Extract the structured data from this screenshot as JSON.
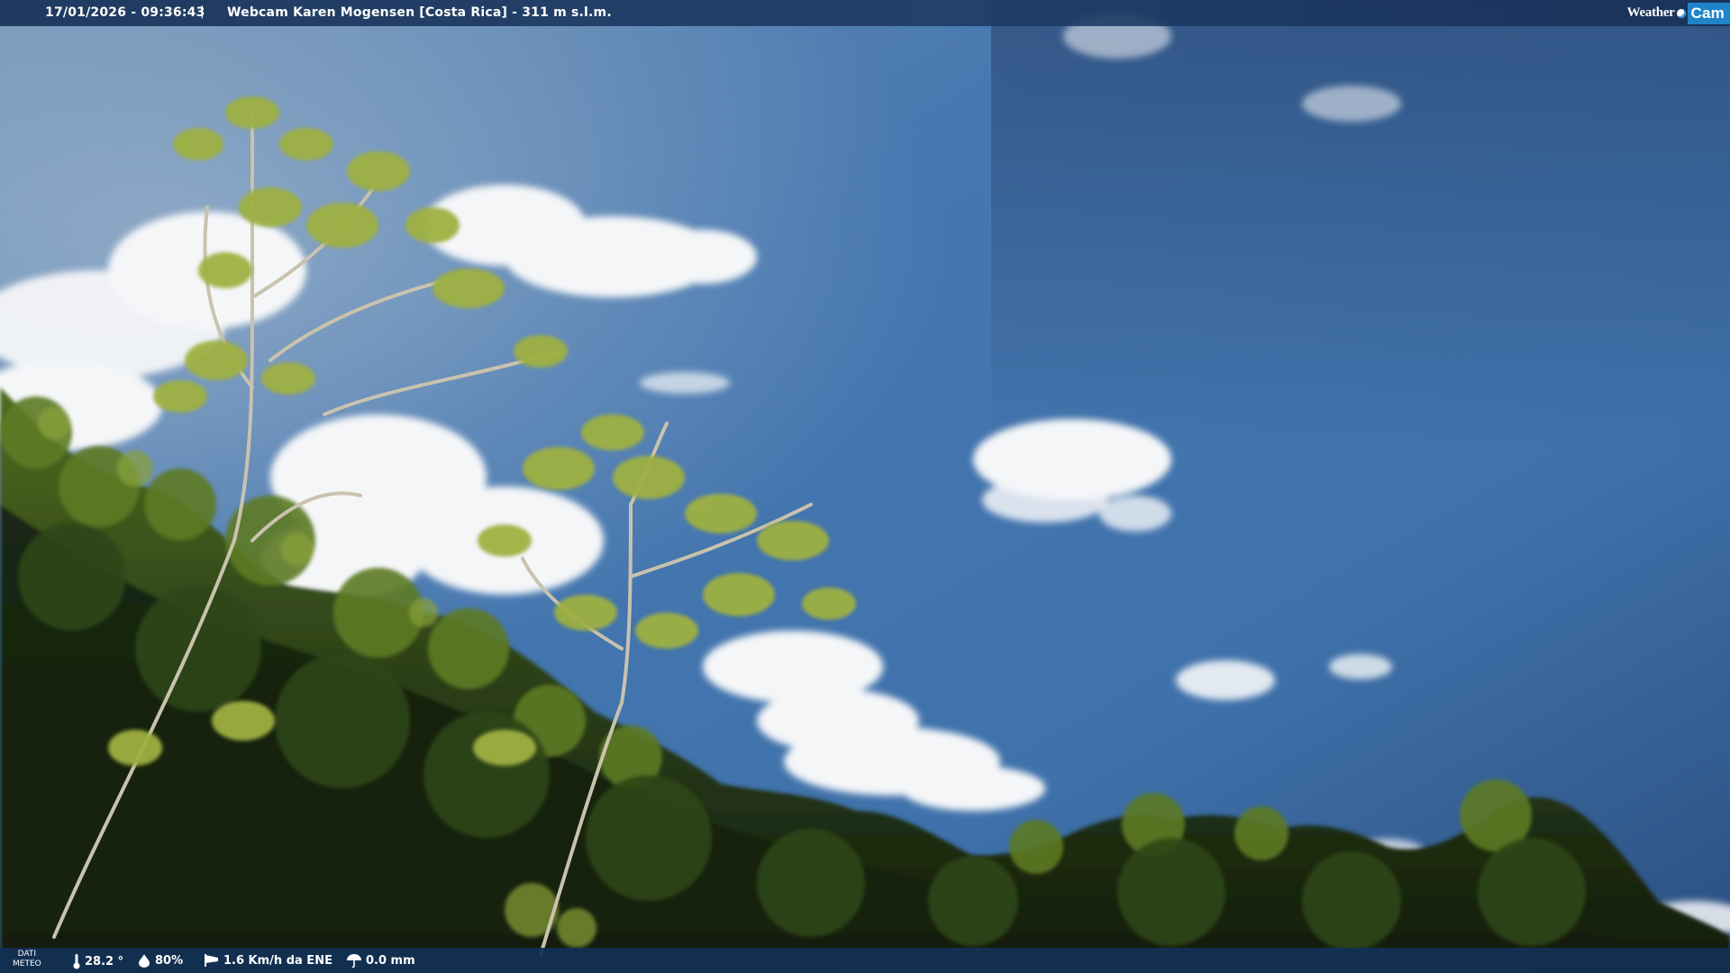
{
  "header": {
    "timestamp": "17/01/2026 - 09:36:43",
    "separator": "|",
    "title": "Webcam Karen Mogensen [Costa Rica] - 311 m s.l.m.",
    "logo_weather": "Weather",
    "logo_cam": "Cam"
  },
  "footer": {
    "dati_line1": "DATI",
    "dati_line2": "METEO",
    "temperature": "28.2 °",
    "humidity": "80%",
    "wind": "1.6 Km/h da ENE",
    "rain": "0.0 mm"
  },
  "icons": {
    "temperature": "thermometer-icon",
    "humidity": "droplet-icon",
    "wind": "windsock-icon",
    "rain": "umbrella-icon",
    "logo_orb": "globe-icon"
  },
  "colors": {
    "sky_top": "#2f4f7e",
    "sky_mid": "#3f77b2",
    "sky_bottom": "#4c86bd",
    "foliage_dark": "#1c2c14",
    "foliage_light": "#6e8a2c",
    "bar_bg": "#183058",
    "logo_blue": "#1f84c8"
  }
}
